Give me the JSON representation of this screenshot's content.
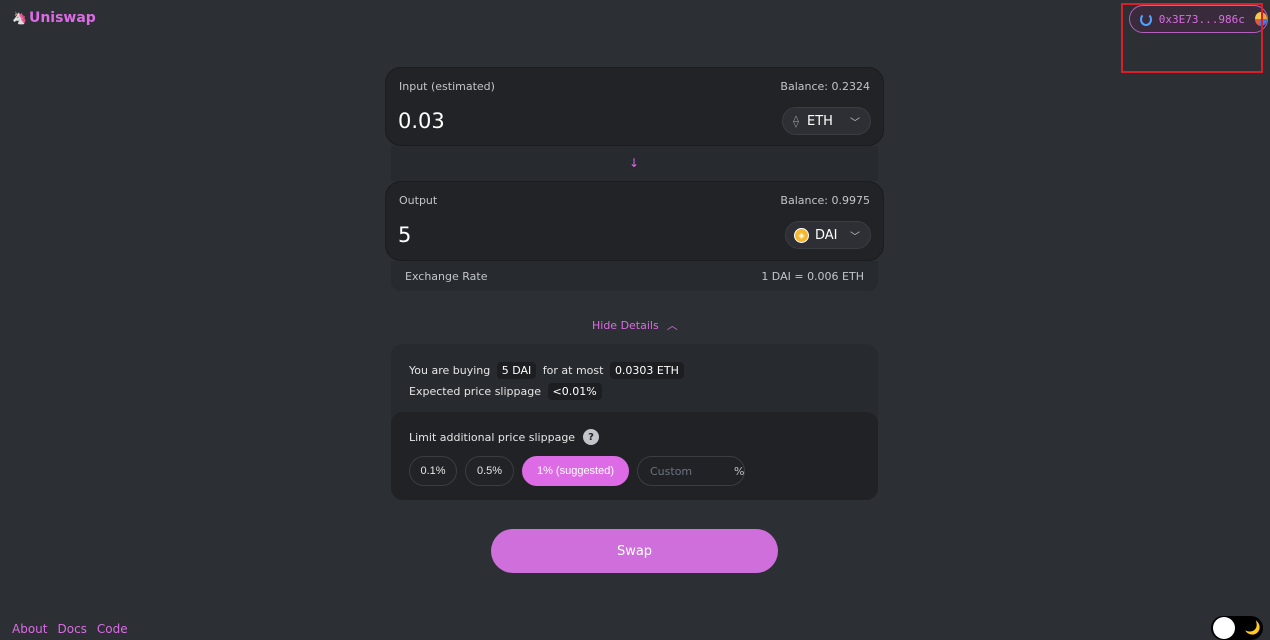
{
  "header": {
    "logo_text": "Uniswap",
    "wallet_address": "0x3E73...986c"
  },
  "input_panel": {
    "label": "Input (estimated)",
    "balance": "Balance: 0.2324",
    "amount": "0.03",
    "token": "ETH"
  },
  "output_panel": {
    "label": "Output",
    "balance": "Balance: 0.9975",
    "amount": "5",
    "token": "DAI"
  },
  "exchange_rate": {
    "label": "Exchange Rate",
    "value": "1 DAI = 0.006 ETH"
  },
  "details_toggle": "Hide Details",
  "details": {
    "buying_prefix": "You are buying",
    "buy_amount": "5 DAI",
    "at_most_text": "for at most",
    "max_cost": "0.0303 ETH",
    "slippage_label": "Expected price slippage",
    "slippage_value": "<0.01%",
    "limit_label": "Limit additional price slippage",
    "help_glyph": "?",
    "options": [
      "0.1%",
      "0.5%",
      "1% (suggested)"
    ],
    "custom_placeholder": "Custom",
    "custom_unit": "%"
  },
  "swap_button": "Swap",
  "footer": {
    "links": [
      "About",
      "Docs",
      "Code"
    ]
  },
  "colors": {
    "background": "#2c2f33",
    "accent": "#dc6be5",
    "panel": "#212326",
    "highlight": "#d9202a"
  },
  "icons": {
    "logo": "unicorn-icon",
    "wallet_status": "spinner-icon",
    "wallet_avatar": "identicon-icon",
    "eth": "eth-icon",
    "dai": "dai-icon",
    "dropdown": "chevron-down-icon",
    "direction": "arrow-down-icon",
    "collapse": "chevron-up-icon",
    "help": "help-icon",
    "theme": "moon-icon"
  }
}
